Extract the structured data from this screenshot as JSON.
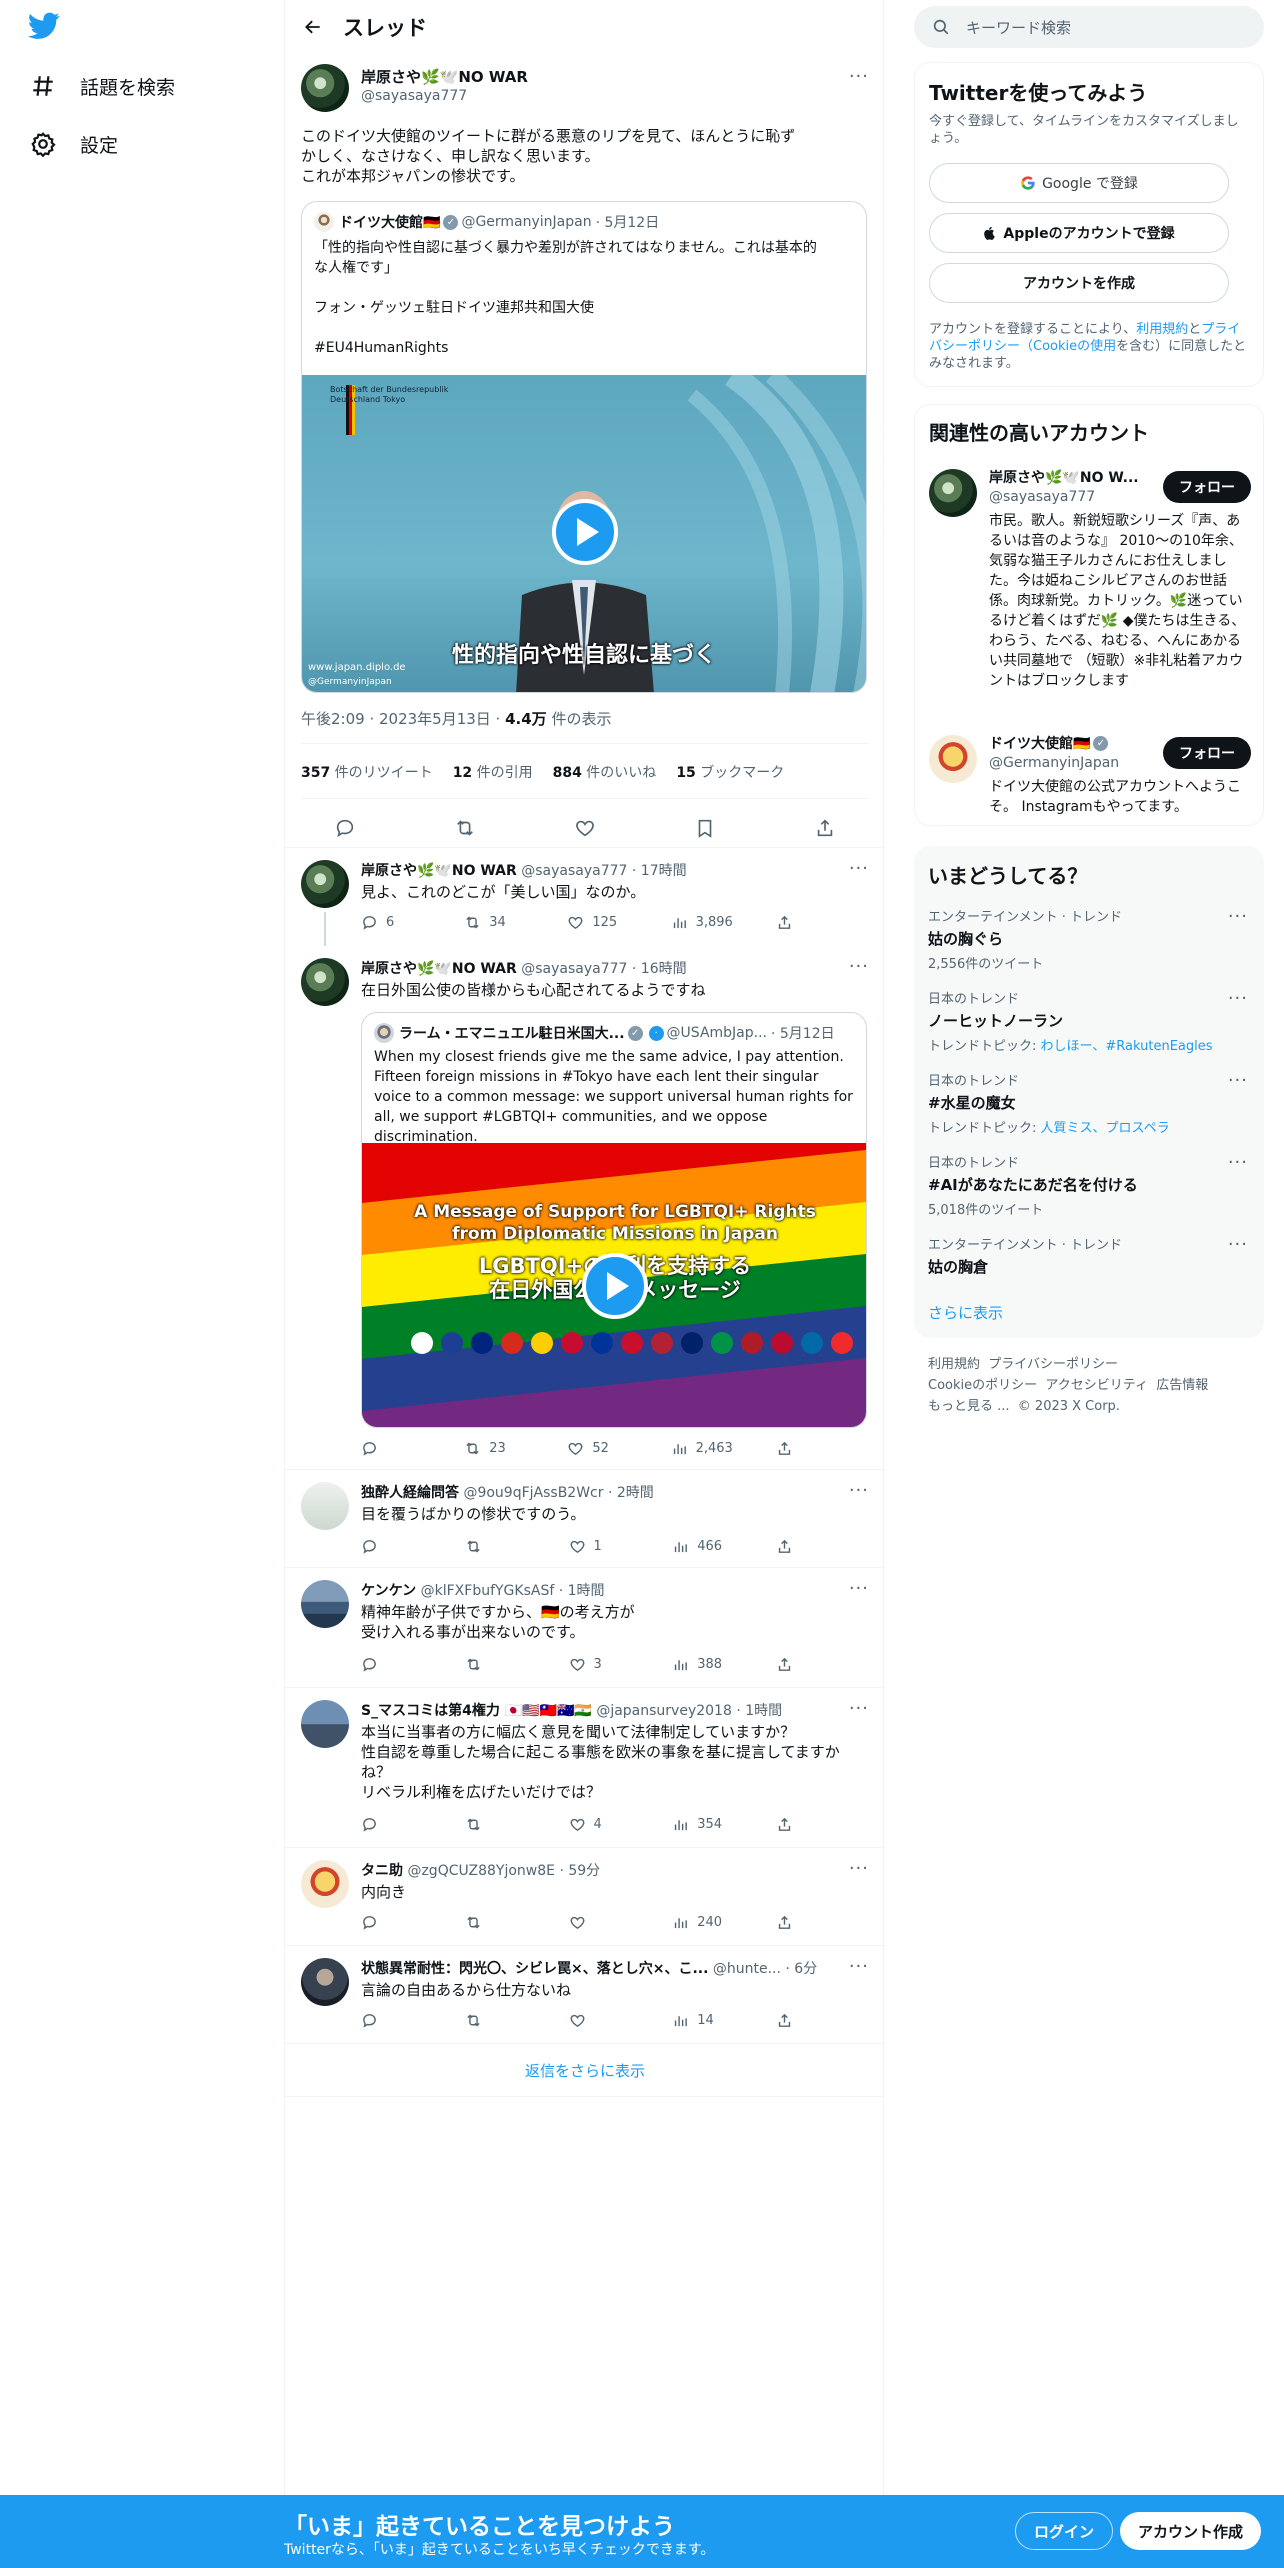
{
  "app": {
    "brand_color": "#1d9bf0"
  },
  "nav": {
    "explore_label": "話題を検索",
    "settings_label": "設定"
  },
  "header": {
    "title": "スレッド"
  },
  "focal": {
    "name": "岸原さや🌿🕊️NO WAR",
    "handle": "@sayasaya777",
    "text_line1": "このドイツ大使館のツイートに群がる悪意のリプを見て、ほんとうに恥ず",
    "text_line2": "かしく、なさけなく、申し訳なく思います。",
    "text_line3": "これが本邦ジャパンの惨状です。",
    "quote": {
      "name": "ドイツ大使館🇩🇪",
      "handle": "@GermanyinJapan",
      "date": "· 5月12日",
      "text_line1": "「性的指向や性自認に基づく暴力や差別が許されてはなりません。これは基本的",
      "text_line2": "な人権です」",
      "text_line3": "フォン・ゲッツェ駐日ドイツ連邦共和国大使",
      "text_line4": "#EU4HumanRights",
      "video_caption": "性的指向や性自認に基づく",
      "video_sign": "Botschaft der Bundesrepublik Deutschland Tokyo",
      "video_url": "www.japan.diplo.de",
      "video_handle": "@GermanyinJapan"
    },
    "time": "午後2:09 · 2023年5月13日 · ",
    "views_count": "4.4万",
    "views_label": " 件の表示",
    "retweets": "357",
    "retweets_label": " 件のリツイート",
    "quotes": "12",
    "quotes_label": " 件の引用",
    "likes": "884",
    "likes_label": " 件のいいね",
    "bookmarks": "15",
    "bookmarks_label": " ブックマーク"
  },
  "replies": [
    {
      "name": "岸原さや🌿🕊️NO WAR",
      "handle": "@sayasaya777",
      "time": "· 17時間",
      "text": "見よ、これのどこが「美しい国」なのか。",
      "replies": "6",
      "retweets": "34",
      "likes": "125",
      "views": "3,896"
    },
    {
      "name": "岸原さや🌿🕊️NO WAR",
      "handle": "@sayasaya777",
      "time": "· 16時間",
      "text": "在日外国公使の皆様からも心配されてるようですね",
      "quote": {
        "name": "ラーム・エマニュエル駐日米国大...",
        "handle": "@USAmbJap...",
        "date": "· 5月12日",
        "text": "When my closest friends give me the same advice, I pay attention. Fifteen foreign missions in #Tokyo have each lent their singular voice to a common message: we support universal human rights for all, we support #LGBTQI+ communities, and we oppose discrimination.",
        "img_line1": "A Message of Support for LGBTQI+ Rights",
        "img_line2": "from Diplomatic Missions in Japan",
        "img_line3": "LGBTQI+の権利を支持する",
        "img_line4": "在日外国公館のメッセージ"
      },
      "replies": "",
      "retweets": "23",
      "likes": "52",
      "views": "2,463"
    },
    {
      "name": "独酔人経綸問答",
      "handle": "@9ou9qFjAssB2Wcr",
      "time": "· 2時間",
      "text": "目を覆うばかりの惨状ですのう。",
      "replies": "",
      "retweets": "",
      "likes": "1",
      "views": "466"
    },
    {
      "name": "ケンケン",
      "handle": "@klFXFbufYGKsASf",
      "time": "· 1時間",
      "text1": "精神年齢が子供ですから、🇩🇪の考え方が",
      "text2": "受け入れる事が出来ないのです。",
      "replies": "",
      "retweets": "",
      "likes": "3",
      "views": "388"
    },
    {
      "name": "S_マスコミは第4権力 🇯🇵🇺🇸🇹🇼🇦🇺🇮🇳",
      "handle": "@japansurvey2018",
      "time": "· 1時間",
      "text1": "本当に当事者の方に幅広く意見を聞いて法律制定していますか？",
      "text2": "性自認を尊重した場合に起こる事態を欧米の事象を基に提言してますか",
      "text3": "ね？",
      "text4": "リベラル利権を広げたいだけでは？",
      "replies": "",
      "retweets": "",
      "likes": "4",
      "views": "354"
    },
    {
      "name": "タニ助",
      "handle": "@zgQCUZ88Yjonw8E",
      "time": "· 59分",
      "text": "内向き",
      "replies": "",
      "retweets": "",
      "likes": "",
      "views": "240"
    },
    {
      "name": "状態異常耐性：閃光〇、シビレ罠×、落とし穴×、こ...",
      "handle": "@hunte...",
      "time": "· 6分",
      "text": "言論の自由あるから仕方ないね",
      "replies": "",
      "retweets": "",
      "likes": "",
      "views": "14"
    }
  ],
  "show_more_replies": "返信をさらに表示",
  "right": {
    "search_placeholder": "キーワード検索",
    "signup_card": {
      "title": "Twitterを使ってみよう",
      "subtitle": "今すぐ登録して、タイムラインをカスタマイズしましょう。",
      "google_label": "Google で登録",
      "apple_label": "Appleのアカウントで登録",
      "create_label": "アカウントを作成",
      "legal_prefix": "アカウントを登録することにより、",
      "legal_terms": "利用規約",
      "legal_and": "と",
      "legal_privacy": "プライバシーポリシー（Cookieの使用",
      "legal_suffix": "を含む）に同意したとみなされます。"
    },
    "related": {
      "title": "関連性の高いアカウント",
      "accounts": [
        {
          "name": "岸原さや🌿🕊️NO W...",
          "handle": "@sayasaya777",
          "follow": "フォロー",
          "bio": "市民。歌人。新鋭短歌シリーズ『声、あるいは音のような』 2010〜の10年余、気弱な猫王子ルカさんにお仕えしました。今は姫ねこシルビアさんのお世話係。肉球新党。カトリック。🌿迷っているけど着くはずだ🌿 ◆僕たちは生きる、わらう、たべる、ねむる、へんにあかるい共同墓地で （短歌）※非礼粘着アカウントはブロックします"
        },
        {
          "name": "ドイツ大使館🇩🇪",
          "handle": "@GermanyinJapan",
          "follow": "フォロー",
          "bio": "ドイツ大使館の公式アカウントへようこそ。 Instagramもやってます。"
        }
      ]
    },
    "trends": {
      "title": "いまどうしてる？",
      "items": [
        {
          "cat": "エンターテインメント · トレンド",
          "title": "姑の胸ぐら",
          "sub": "2,556件のツイート"
        },
        {
          "cat": "日本のトレンド",
          "title": "ノーヒットノーラン",
          "sub_prefix": "トレンドトピック: ",
          "sub_link": "わしほー、#RakutenEagles"
        },
        {
          "cat": "日本のトレンド",
          "title": "#水星の魔女",
          "sub_prefix": "トレンドトピック: ",
          "sub_link": "人質ミス、プロスペラ"
        },
        {
          "cat": "日本のトレンド",
          "title": "#AIがあなたにあだ名を付ける",
          "sub": "5,018件のツイート"
        },
        {
          "cat": "エンターテインメント · トレンド",
          "title": "姑の胸倉"
        }
      ],
      "show_more": "さらに表示"
    },
    "footer": {
      "l1": "利用規約",
      "l2": "プライバシーポリシー",
      "l3": "Cookieのポリシー",
      "l4": "アクセシビリティ",
      "l5": "広告情報",
      "l6": "もっと見る ...",
      "l7": "© 2023 X Corp."
    }
  },
  "banner": {
    "title": "「いま」起きていることを見つけよう",
    "subtitle": "Twitterなら、「いま」起きていることをいち早くチェックできます。",
    "login": "ログイン",
    "signup": "アカウント作成"
  }
}
